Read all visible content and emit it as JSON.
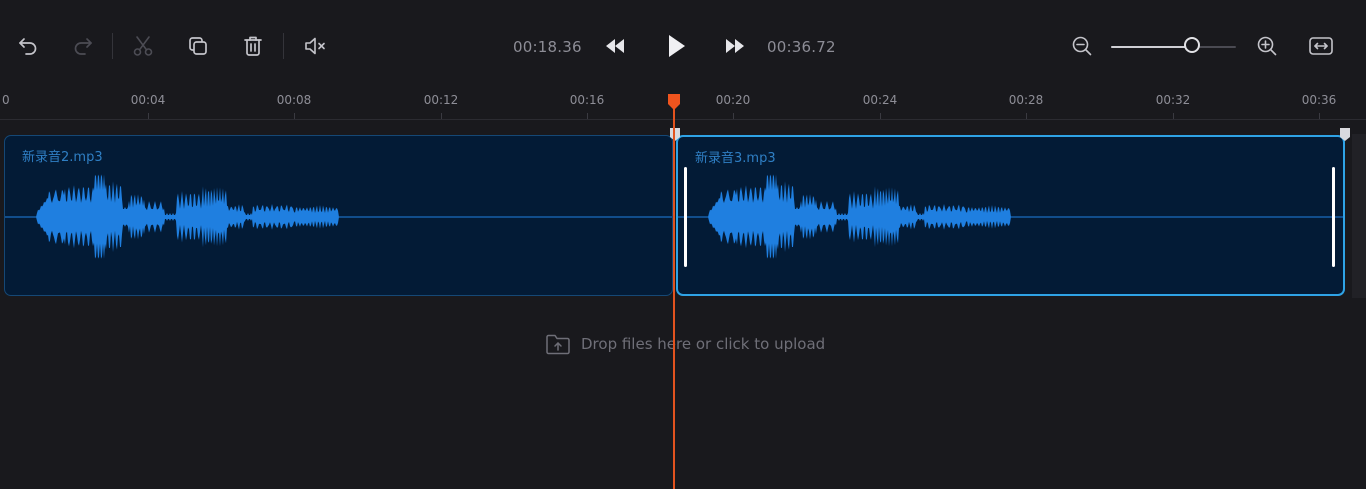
{
  "toolbar": {
    "buttons": [
      {
        "name": "undo-button",
        "icon": "undo-icon",
        "enabled": true
      },
      {
        "name": "redo-button",
        "icon": "redo-icon",
        "enabled": false
      },
      {
        "name": "cut-button",
        "icon": "scissors-icon",
        "enabled": false
      },
      {
        "name": "duplicate-button",
        "icon": "copy-icon",
        "enabled": true
      },
      {
        "name": "delete-button",
        "icon": "trash-icon",
        "enabled": true
      },
      {
        "name": "mute-button",
        "icon": "speaker-mute-icon",
        "enabled": true
      }
    ],
    "current_time": "00:18.36",
    "total_time": "00:36.72",
    "zoom_level_fraction": 0.65,
    "fit_button_icon": "fit-width-icon"
  },
  "ruler": {
    "ticks": [
      "0",
      "00:04",
      "00:08",
      "00:12",
      "00:16",
      "00:20",
      "00:24",
      "00:28",
      "00:32",
      "00:36"
    ]
  },
  "timeline": {
    "playhead_time": "00:18.36",
    "clips": [
      {
        "name": "新录音2.mp3",
        "selected": false
      },
      {
        "name": "新录音3.mp3",
        "selected": true
      }
    ]
  },
  "upload": {
    "text": "Drop files here or click to upload",
    "icon": "folder-upload-icon"
  },
  "colors": {
    "background": "#19191d",
    "clip_background": "#031b36",
    "waveform": "#1f7fe0",
    "selected_border": "#2fa3e6",
    "playhead": "#e2531f"
  }
}
